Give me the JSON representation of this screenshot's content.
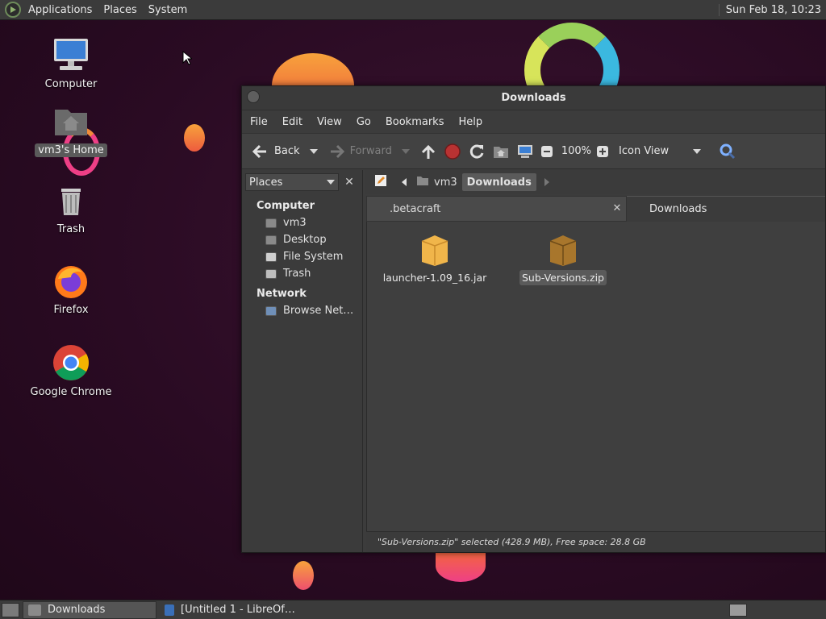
{
  "top_panel": {
    "menus": [
      "Applications",
      "Places",
      "System"
    ],
    "clock": "Sun Feb 18, 10:23"
  },
  "desktop": {
    "icons": [
      {
        "label": "Computer",
        "icon": "computer-icon"
      },
      {
        "label": "vm3's Home",
        "icon": "home-folder-icon"
      },
      {
        "label": "Trash",
        "icon": "trash-icon"
      },
      {
        "label": "Firefox",
        "icon": "firefox-icon"
      },
      {
        "label": "Google Chrome",
        "icon": "chrome-icon"
      }
    ]
  },
  "window": {
    "title": "Downloads",
    "menus": [
      "File",
      "Edit",
      "View",
      "Go",
      "Bookmarks",
      "Help"
    ],
    "toolbar": {
      "back": "Back",
      "forward": "Forward",
      "zoom": "100%",
      "view_mode": "Icon View"
    },
    "sidebar": {
      "selector": "Places",
      "sections": [
        {
          "heading": "Computer",
          "items": [
            "vm3",
            "Desktop",
            "File System",
            "Trash"
          ]
        },
        {
          "heading": "Network",
          "items": [
            "Browse Net…"
          ]
        }
      ]
    },
    "pathbar": {
      "segments": [
        "vm3",
        "Downloads"
      ]
    },
    "tabs": [
      ".betacraft",
      "Downloads"
    ],
    "files": [
      {
        "name": "launcher-1.09_16.jar",
        "icon": "jar-package-icon",
        "selected": false
      },
      {
        "name": "Sub-Versions.zip",
        "icon": "zip-archive-icon",
        "selected": true
      }
    ],
    "status": "\"Sub-Versions.zip\" selected (428.9 MB), Free space: 28.8 GB"
  },
  "taskbar": {
    "tasks": [
      "Downloads",
      "[Untitled 1 - LibreOf…"
    ]
  },
  "colors": {
    "wallpaper": "#2a0d22",
    "panel": "#3b3b3b",
    "selection": "#5a5a5a",
    "orange_blob": "#f08a3a",
    "pink_blob": "#ee3f86"
  }
}
